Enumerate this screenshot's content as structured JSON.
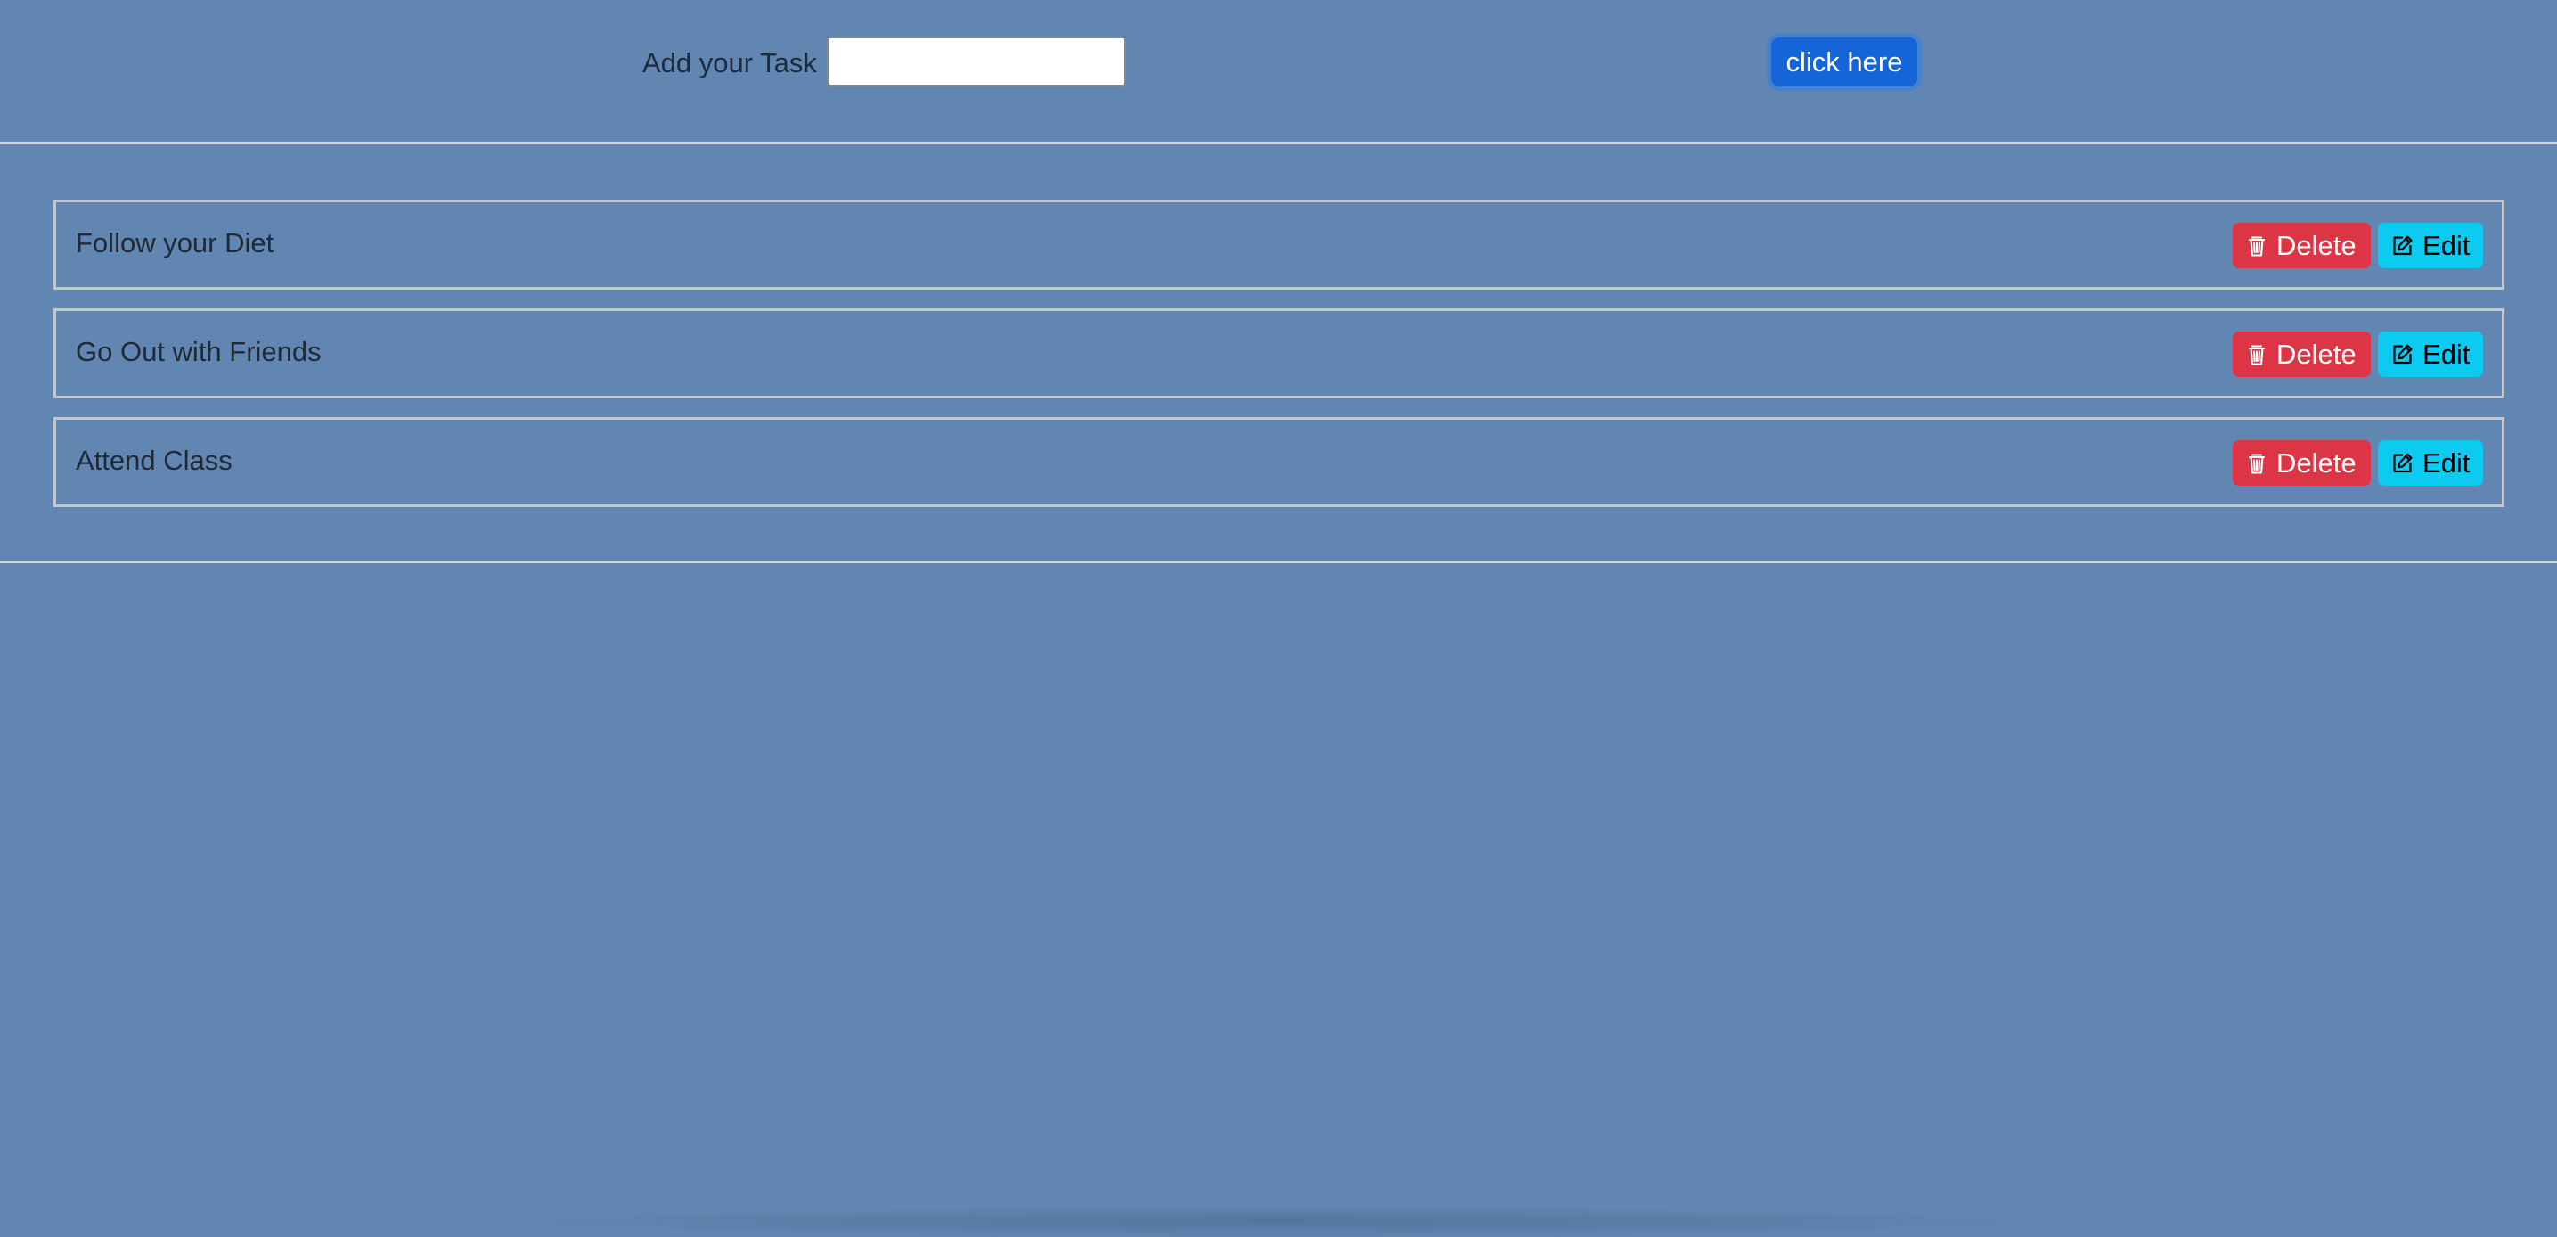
{
  "colors": {
    "background": "#6186b1",
    "primary": "#1565d8",
    "danger": "#dc3545",
    "info": "#0dcaf0",
    "divider": "#d2d8df"
  },
  "header": {
    "add_label": "Add your Task",
    "input_value": "",
    "input_placeholder": "",
    "submit_label": "click here"
  },
  "tasks": [
    {
      "text": "Follow your Diet",
      "delete_label": "Delete",
      "edit_label": "Edit",
      "delete_icon": "trash-icon",
      "edit_icon": "edit-icon"
    },
    {
      "text": "Go Out with Friends",
      "delete_label": "Delete",
      "edit_label": "Edit",
      "delete_icon": "trash-icon",
      "edit_icon": "edit-icon"
    },
    {
      "text": "Attend Class",
      "delete_label": "Delete",
      "edit_label": "Edit",
      "delete_icon": "trash-icon",
      "edit_icon": "edit-icon"
    }
  ]
}
